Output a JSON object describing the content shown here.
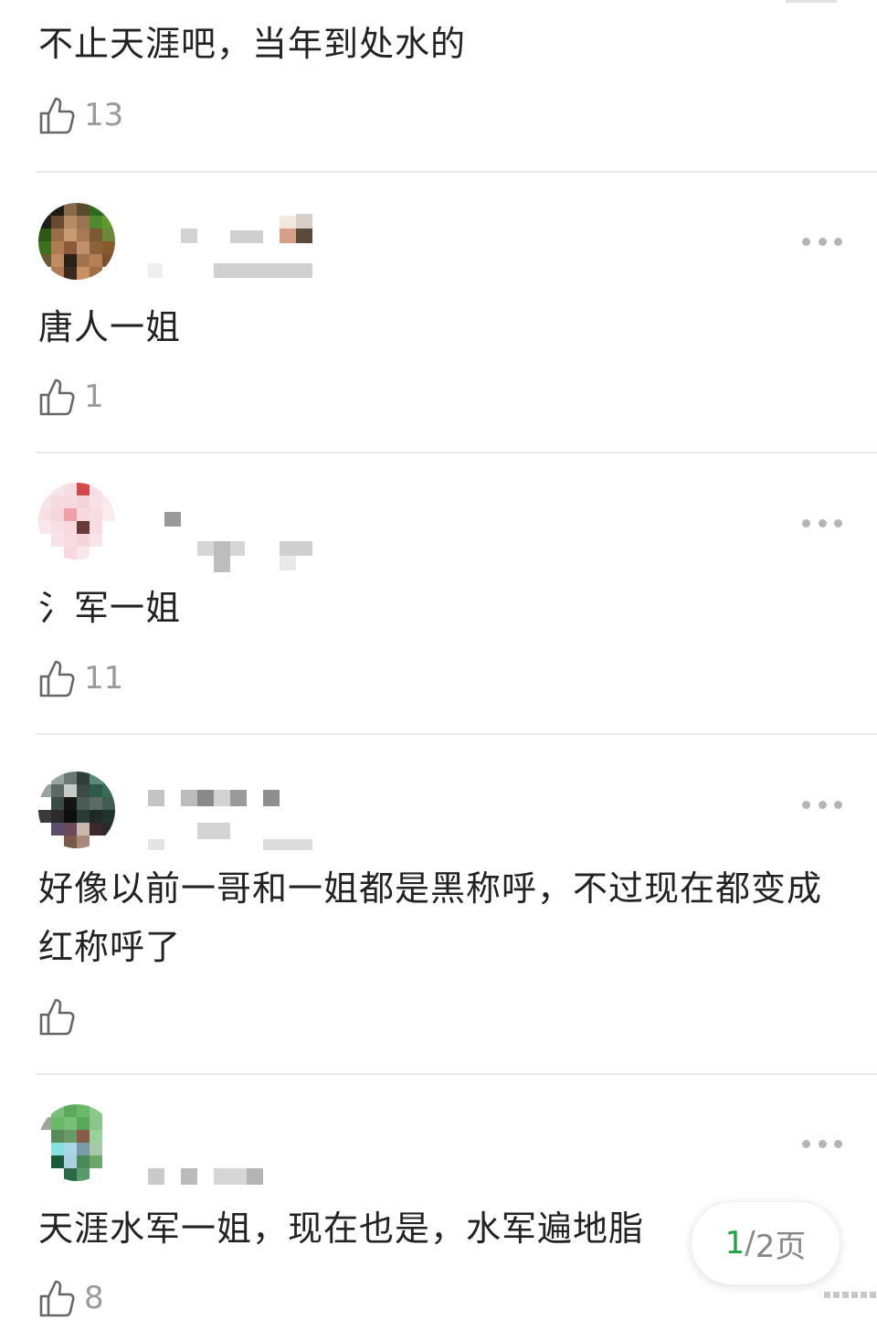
{
  "comments": [
    {
      "text": "不止天涯吧，当年到处水的",
      "likes": "13"
    },
    {
      "text": "唐人一姐",
      "likes": "1"
    },
    {
      "text": "氵军一姐",
      "likes": "11"
    },
    {
      "text": "好像以前一哥和一姐都是黑称呼，不过现在都变成红称呼了",
      "likes": ""
    },
    {
      "text": "天涯水军一姐，现在也是，水军遍地脂",
      "likes": "8"
    }
  ],
  "pager": {
    "current": "1",
    "separator": "/",
    "total_label": "2页"
  },
  "icons": {
    "like": "thumbs-up-icon",
    "more": "more-dots-icon"
  },
  "colors": {
    "accent_page": "#22a04a",
    "muted_text": "#9a9a9a",
    "divider": "#e8e8e8"
  }
}
